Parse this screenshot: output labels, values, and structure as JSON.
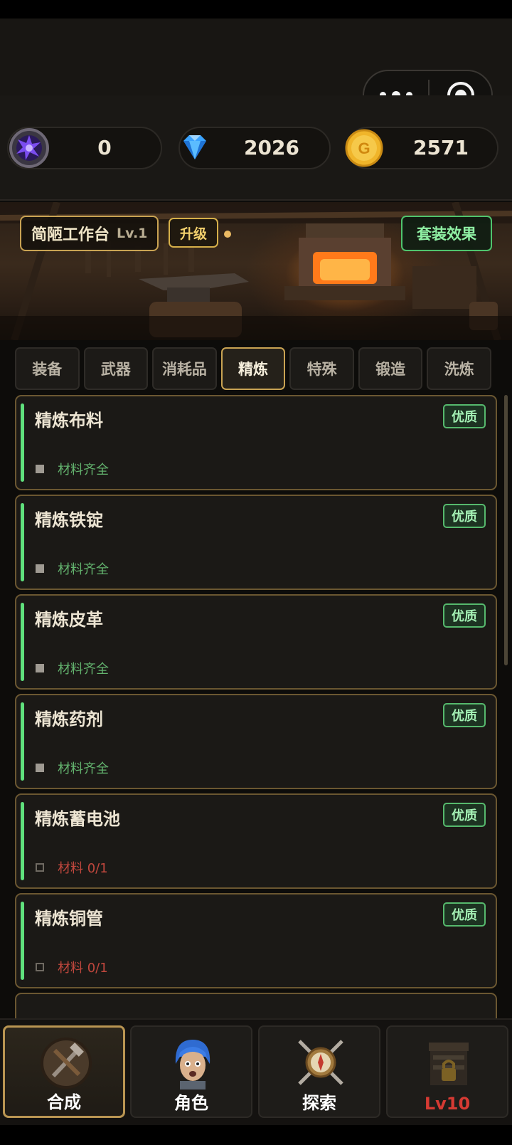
{
  "top_bar": {
    "menu_icon": "more-dots-icon",
    "close_icon": "target-circle-icon"
  },
  "currencies": [
    {
      "icon": "purple-crystal-orb-icon",
      "value": "0",
      "color": "#6b3fd9"
    },
    {
      "icon": "blue-diamond-icon",
      "value": "2026",
      "color": "#3aa3ff"
    },
    {
      "icon": "gold-coin-icon",
      "value": "2571",
      "color": "#f0b52a"
    }
  ],
  "workbench": {
    "name": "简陋工作台",
    "level": "Lv.1",
    "upgrade_label": "升级",
    "set_effect_label": "套装效果"
  },
  "tabs": [
    {
      "label": "装备",
      "active": false
    },
    {
      "label": "武器",
      "active": false
    },
    {
      "label": "消耗品",
      "active": false
    },
    {
      "label": "精炼",
      "active": true
    },
    {
      "label": "特殊",
      "active": false
    },
    {
      "label": "锻造",
      "active": false
    },
    {
      "label": "洗炼",
      "active": false
    }
  ],
  "recipes": [
    {
      "name": "精炼布料",
      "quality": "优质",
      "status": "材料齐全",
      "complete": true
    },
    {
      "name": "精炼铁锭",
      "quality": "优质",
      "status": "材料齐全",
      "complete": true
    },
    {
      "name": "精炼皮革",
      "quality": "优质",
      "status": "材料齐全",
      "complete": true
    },
    {
      "name": "精炼药剂",
      "quality": "优质",
      "status": "材料齐全",
      "complete": true
    },
    {
      "name": "精炼蓄电池",
      "quality": "优质",
      "status": "材料 0/1",
      "complete": false
    },
    {
      "name": "精炼铜管",
      "quality": "优质",
      "status": "材料 0/1",
      "complete": false
    }
  ],
  "colors": {
    "accent_gold": "#c9a353",
    "quality_green": "#56b96d",
    "status_ok": "#63b36e",
    "status_missing": "#c0473d",
    "level_red": "#d63a33"
  },
  "bottom_nav": [
    {
      "label": "合成",
      "icon": "crafting-tools-icon",
      "active": true
    },
    {
      "label": "角色",
      "icon": "character-portrait-icon",
      "active": false
    },
    {
      "label": "探索",
      "icon": "compass-swords-icon",
      "active": false
    },
    {
      "label": "Lv10",
      "icon": "locked-shop-icon",
      "active": false,
      "locked": true
    }
  ]
}
